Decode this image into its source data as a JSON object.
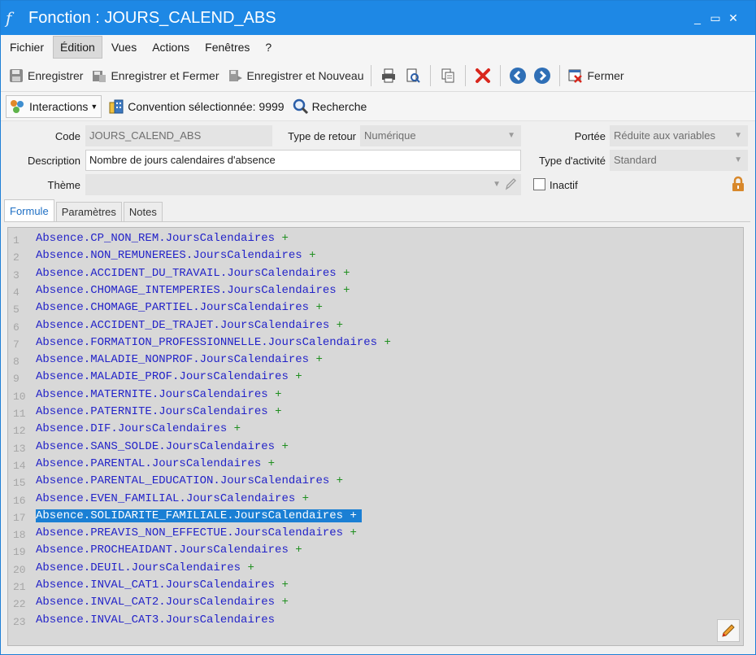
{
  "window": {
    "title": "Fonction : JOURS_CALEND_ABS",
    "controls": [
      "_",
      "▭",
      "✕"
    ]
  },
  "menu": [
    "Fichier",
    "Édition",
    "Vues",
    "Actions",
    "Fenêtres",
    "?"
  ],
  "toolbar": {
    "save": "Enregistrer",
    "save_close": "Enregistrer et Fermer",
    "save_new": "Enregistrer et Nouveau",
    "close": "Fermer"
  },
  "toolbar2": {
    "interactions": "Interactions",
    "convention": "Convention sélectionnée: 9999",
    "search": "Recherche"
  },
  "form": {
    "code_label": "Code",
    "code_value": "JOURS_CALEND_ABS",
    "return_type_label": "Type de retour",
    "return_type_value": "Numérique",
    "scope_label": "Portée",
    "scope_value": "Réduite aux variables",
    "description_label": "Description",
    "description_value": "Nombre de jours calendaires d'absence",
    "activity_type_label": "Type d'activité",
    "activity_type_value": "Standard",
    "theme_label": "Thème",
    "theme_value": "",
    "inactive_label": "Inactif"
  },
  "tabs": [
    "Formule",
    "Paramètres",
    "Notes"
  ],
  "formula": {
    "selected_line": 17,
    "lines": [
      {
        "n": "1",
        "code": "Absence.CP_NON_REM.JoursCalendaires",
        "plus": "+"
      },
      {
        "n": "2",
        "code": "Absence.NON_REMUNEREES.JoursCalendaires",
        "plus": "+"
      },
      {
        "n": "3",
        "code": "Absence.ACCIDENT_DU_TRAVAIL.JoursCalendaires",
        "plus": "+"
      },
      {
        "n": "4",
        "code": "Absence.CHOMAGE_INTEMPERIES.JoursCalendaires",
        "plus": "+"
      },
      {
        "n": "5",
        "code": "Absence.CHOMAGE_PARTIEL.JoursCalendaires",
        "plus": "+"
      },
      {
        "n": "6",
        "code": "Absence.ACCIDENT_DE_TRAJET.JoursCalendaires",
        "plus": "+"
      },
      {
        "n": "7",
        "code": "Absence.FORMATION_PROFESSIONNELLE.JoursCalendaires",
        "plus": "+"
      },
      {
        "n": "8",
        "code": "Absence.MALADIE_NONPROF.JoursCalendaires",
        "plus": "+"
      },
      {
        "n": "9",
        "code": "Absence.MALADIE_PROF.JoursCalendaires",
        "plus": "+"
      },
      {
        "n": "10",
        "code": "Absence.MATERNITE.JoursCalendaires",
        "plus": "+"
      },
      {
        "n": "11",
        "code": "Absence.PATERNITE.JoursCalendaires",
        "plus": "+"
      },
      {
        "n": "12",
        "code": "Absence.DIF.JoursCalendaires",
        "plus": "+"
      },
      {
        "n": "13",
        "code": "Absence.SANS_SOLDE.JoursCalendaires",
        "plus": "+"
      },
      {
        "n": "14",
        "code": "Absence.PARENTAL.JoursCalendaires",
        "plus": "+"
      },
      {
        "n": "15",
        "code": "Absence.PARENTAL_EDUCATION.JoursCalendaires",
        "plus": "+"
      },
      {
        "n": "16",
        "code": "Absence.EVEN_FAMILIAL.JoursCalendaires",
        "plus": "+"
      },
      {
        "n": "17",
        "code": "Absence.SOLIDARITE_FAMILIALE.JoursCalendaires",
        "plus": "+"
      },
      {
        "n": "18",
        "code": "Absence.PREAVIS_NON_EFFECTUE.JoursCalendaires",
        "plus": "+"
      },
      {
        "n": "19",
        "code": "Absence.PROCHEAIDANT.JoursCalendaires",
        "plus": "+"
      },
      {
        "n": "20",
        "code": "Absence.DEUIL.JoursCalendaires",
        "plus": "+"
      },
      {
        "n": "21",
        "code": "Absence.INVAL_CAT1.JoursCalendaires",
        "plus": "+"
      },
      {
        "n": "22",
        "code": "Absence.INVAL_CAT2.JoursCalendaires",
        "plus": "+"
      },
      {
        "n": "23",
        "code": "Absence.INVAL_CAT3.JoursCalendaires",
        "plus": ""
      }
    ]
  }
}
